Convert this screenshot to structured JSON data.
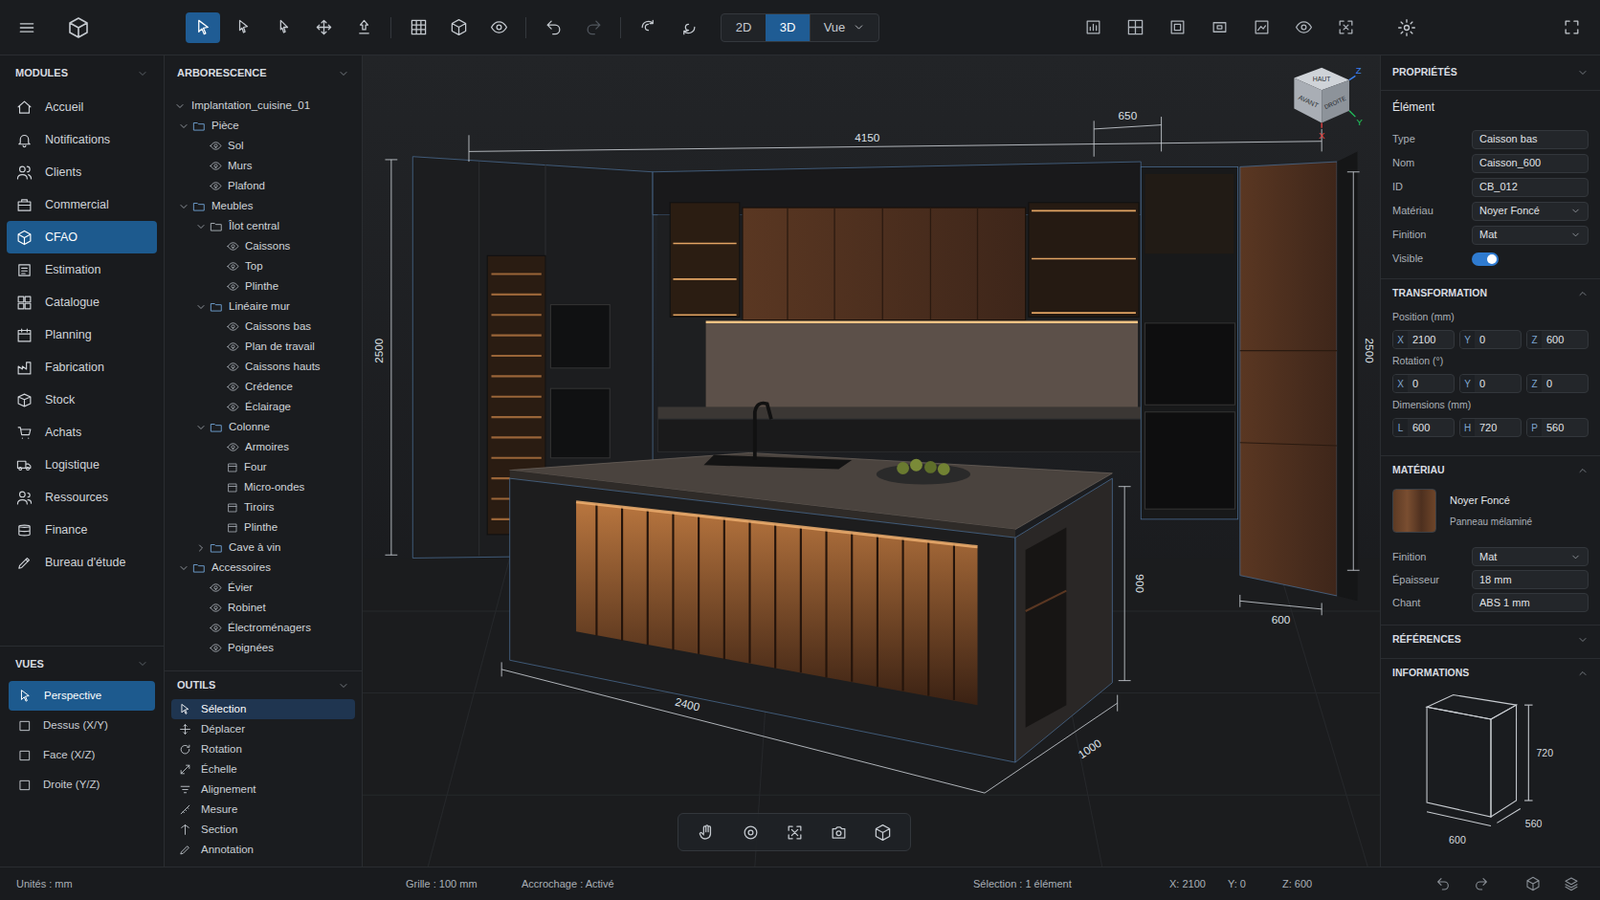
{
  "toolbar": {
    "tools": [
      {
        "selected": true,
        "disabled": false
      },
      {
        "selected": false,
        "disabled": false
      },
      {
        "selected": false,
        "disabled": false
      },
      {
        "selected": false,
        "disabled": false
      },
      {
        "selected": false,
        "disabled": false
      },
      {
        "selected": false,
        "disabled": false
      },
      {
        "selected": false,
        "disabled": false
      },
      {
        "selected": false,
        "disabled": false
      },
      {
        "selected": false,
        "disabled": false
      },
      {
        "selected": false,
        "disabled": true
      },
      {
        "selected": false,
        "disabled": false
      },
      {
        "selected": false,
        "disabled": false
      }
    ],
    "view_modes": [
      {
        "label": "2D",
        "selected": false
      },
      {
        "label": "3D",
        "selected": true
      }
    ],
    "view_menu": {
      "label": "Vue"
    }
  },
  "modules": {
    "title": "MODULES",
    "items": [
      {
        "label": "Accueil",
        "selected": false
      },
      {
        "label": "Notifications",
        "selected": false
      },
      {
        "label": "Clients",
        "selected": false
      },
      {
        "label": "Commercial",
        "selected": false
      },
      {
        "label": "CFAO",
        "selected": true
      },
      {
        "label": "Estimation",
        "selected": false
      },
      {
        "label": "Catalogue",
        "selected": false
      },
      {
        "label": "Planning",
        "selected": false
      },
      {
        "label": "Fabrication",
        "selected": false
      },
      {
        "label": "Stock",
        "selected": false
      },
      {
        "label": "Achats",
        "selected": false
      },
      {
        "label": "Logistique",
        "selected": false
      },
      {
        "label": "Ressources",
        "selected": false
      },
      {
        "label": "Finance",
        "selected": false
      },
      {
        "label": "Bureau d'étude",
        "selected": false
      }
    ]
  },
  "views": {
    "title": "VUES",
    "items": [
      {
        "label": "Perspective",
        "selected": true
      },
      {
        "label": "Dessus (X/Y)",
        "selected": false
      },
      {
        "label": "Face (X/Z)",
        "selected": false
      },
      {
        "label": "Droite (Y/Z)",
        "selected": false
      }
    ]
  },
  "tree": {
    "title": "ARBORESCENCE",
    "nodes": [
      {
        "label": "Implantation_cuisine_01",
        "kind": "root",
        "expanded": true,
        "children": [
          {
            "label": "Pièce",
            "kind": "folder",
            "expanded": true,
            "children": [
              {
                "label": "Sol",
                "kind": "eye"
              },
              {
                "label": "Murs",
                "kind": "eye"
              },
              {
                "label": "Plafond",
                "kind": "eye"
              }
            ]
          },
          {
            "label": "Meubles",
            "kind": "folder",
            "expanded": true,
            "children": [
              {
                "label": "Îlot central",
                "kind": "subfolder",
                "expanded": true,
                "children": [
                  {
                    "label": "Caissons",
                    "kind": "eye"
                  },
                  {
                    "label": "Top",
                    "kind": "eye"
                  },
                  {
                    "label": "Plinthe",
                    "kind": "eye"
                  }
                ]
              },
              {
                "label": "Linéaire mur",
                "kind": "folder",
                "expanded": true,
                "children": [
                  {
                    "label": "Caissons bas",
                    "kind": "eye"
                  },
                  {
                    "label": "Plan de travail",
                    "kind": "eye"
                  },
                  {
                    "label": "Caissons hauts",
                    "kind": "eye"
                  },
                  {
                    "label": "Crédence",
                    "kind": "eye"
                  },
                  {
                    "label": "Éclairage",
                    "kind": "eye"
                  }
                ]
              },
              {
                "label": "Colonne",
                "kind": "folder",
                "expanded": true,
                "children": [
                  {
                    "label": "Armoires",
                    "kind": "eye"
                  },
                  {
                    "label": "Four",
                    "kind": "box"
                  },
                  {
                    "label": "Micro-ondes",
                    "kind": "box"
                  },
                  {
                    "label": "Tiroirs",
                    "kind": "box"
                  },
                  {
                    "label": "Plinthe",
                    "kind": "box"
                  }
                ]
              },
              {
                "label": "Cave à vin",
                "kind": "folder",
                "expanded": false,
                "children": []
              }
            ]
          },
          {
            "label": "Accessoires",
            "kind": "folder",
            "expanded": true,
            "children": [
              {
                "label": "Évier",
                "kind": "eye"
              },
              {
                "label": "Robinet",
                "kind": "eye"
              },
              {
                "label": "Électroménagers",
                "kind": "eye"
              },
              {
                "label": "Poignées",
                "kind": "eye"
              }
            ]
          }
        ]
      }
    ]
  },
  "tools_panel": {
    "title": "OUTILS",
    "items": [
      {
        "label": "Sélection",
        "selected": true
      },
      {
        "label": "Déplacer",
        "selected": false
      },
      {
        "label": "Rotation",
        "selected": false
      },
      {
        "label": "Échelle",
        "selected": false
      },
      {
        "label": "Alignement",
        "selected": false
      },
      {
        "label": "Mesure",
        "selected": false
      },
      {
        "label": "Section",
        "selected": false
      },
      {
        "label": "Annotation",
        "selected": false
      }
    ]
  },
  "viewport": {
    "dimensions": [
      {
        "text": "4150"
      },
      {
        "text": "650"
      },
      {
        "text": "2500"
      },
      {
        "text": "2500"
      },
      {
        "text": "2400"
      },
      {
        "text": "1000"
      },
      {
        "text": "900"
      },
      {
        "text": "600"
      }
    ],
    "view_cube": {
      "top": "HAUT",
      "front": "AVANT",
      "right": "DROITE"
    },
    "axes": {
      "z": "Z",
      "y": "Y",
      "x": "X"
    }
  },
  "properties": {
    "title": "PROPRIÉTÉS",
    "section": "Élément",
    "fields": [
      {
        "label": "Type",
        "value": "Caisson bas",
        "kind": "text"
      },
      {
        "label": "Nom",
        "value": "Caisson_600",
        "kind": "text"
      },
      {
        "label": "ID",
        "value": "CB_012",
        "kind": "text"
      },
      {
        "label": "Matériau",
        "value": "Noyer Foncé",
        "kind": "select"
      },
      {
        "label": "Finition",
        "value": "Mat",
        "kind": "select"
      },
      {
        "label": "Visible",
        "kind": "toggle",
        "on": true
      }
    ],
    "transformation": {
      "title": "TRANSFORMATION",
      "expanded": true,
      "groups": [
        {
          "label": "Position (mm)",
          "values": [
            {
              "axis": "X",
              "value": "2100"
            },
            {
              "axis": "Y",
              "value": "0"
            },
            {
              "axis": "Z",
              "value": "600"
            }
          ]
        },
        {
          "label": "Rotation (°)",
          "values": [
            {
              "axis": "X",
              "value": "0"
            },
            {
              "axis": "Y",
              "value": "0"
            },
            {
              "axis": "Z",
              "value": "0"
            }
          ]
        },
        {
          "label": "Dimensions (mm)",
          "values": [
            {
              "axis": "L",
              "value": "600"
            },
            {
              "axis": "H",
              "value": "720"
            },
            {
              "axis": "P",
              "value": "560"
            }
          ]
        }
      ]
    },
    "material": {
      "title": "MATÉRIAU",
      "expanded": true,
      "name": "Noyer Foncé",
      "description": "Panneau mélaminé",
      "fields": [
        {
          "label": "Finition",
          "value": "Mat",
          "kind": "select"
        },
        {
          "label": "Épaisseur",
          "value": "18 mm",
          "kind": "text"
        },
        {
          "label": "Chant",
          "value": "ABS 1 mm",
          "kind": "text"
        }
      ]
    },
    "references": {
      "title": "RÉFÉRENCES",
      "expanded": false
    },
    "information": {
      "title": "INFORMATIONS",
      "expanded": true,
      "height": "720",
      "depth": "560",
      "width": "600"
    }
  },
  "status_bar": {
    "units": "Unités : mm",
    "grid": "Grille : 100 mm",
    "snap": "Accrochage : Activé",
    "selection": "Sélection : 1 élément",
    "x": "X: 2100",
    "y": "Y: 0",
    "z": "Z: 600"
  }
}
